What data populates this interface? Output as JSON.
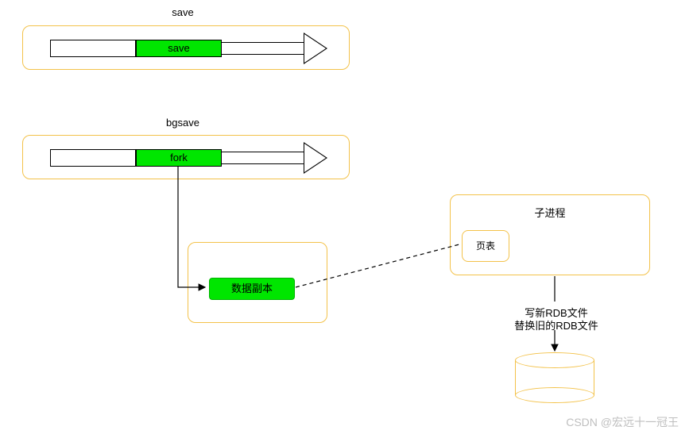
{
  "save": {
    "title": "save",
    "block_label": "save"
  },
  "bgsave": {
    "title": "bgsave",
    "block_label": "fork"
  },
  "data_copy": {
    "label": "数据副本"
  },
  "child_process": {
    "title": "子进程",
    "page_table": "页表"
  },
  "rdb_text": {
    "line1": "写新RDB文件",
    "line2": "替换旧的RDB文件"
  },
  "watermark": "CSDN @宏远十一冠王"
}
